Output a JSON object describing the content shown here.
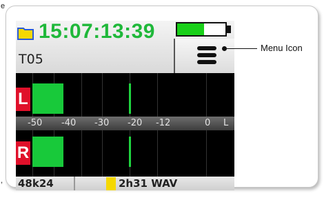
{
  "edge_fragments": {
    "top_left": "e",
    "bottom_left": ","
  },
  "header": {
    "timecode": "15:07:13:39",
    "take_name": "T05",
    "battery_level": 0.55,
    "menu_icon": "menu-icon"
  },
  "meters": {
    "channels": [
      {
        "label": "L",
        "level_db": -39,
        "peak_db": -20
      },
      {
        "label": "R",
        "level_db": -39,
        "peak_db": -20
      }
    ],
    "scale": [
      "-50",
      "-40",
      "-30",
      "-20",
      "-12",
      "0",
      "L"
    ]
  },
  "status": {
    "sample_rate": "48k24",
    "file_info": "2h31 WAV"
  },
  "callout": {
    "label": "Menu Icon"
  },
  "colors": {
    "timecode": "#1fb83a",
    "channel_badge": "#e0102a",
    "meter_bar": "#18c93a",
    "file_tag": "#f5d800",
    "folder": "#f5d800"
  }
}
